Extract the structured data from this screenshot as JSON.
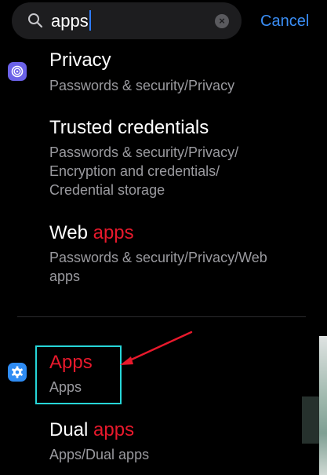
{
  "search": {
    "value": "apps",
    "cancel_label": "Cancel"
  },
  "results": [
    {
      "title_pre": "Privacy",
      "title_hl": "",
      "path_lines": [
        "Passwords & security/Privacy"
      ]
    },
    {
      "title_pre": "Trusted credentials",
      "title_hl": "",
      "path_lines": [
        "Passwords & security/Privacy/",
        "Encryption and credentials/",
        "Credential storage"
      ]
    },
    {
      "title_pre": "Web ",
      "title_hl": "apps",
      "path_lines": [
        "Passwords & security/Privacy/Web",
        "apps"
      ]
    },
    {
      "title_pre": "",
      "title_hl": "Apps",
      "path_lines": [
        "Apps"
      ]
    },
    {
      "title_pre": "Dual ",
      "title_hl": "apps",
      "path_lines": [
        "Apps/Dual apps"
      ]
    }
  ],
  "icons": {
    "search": "search-icon",
    "clear": "clear-icon",
    "privacy": "privacy-icon",
    "settings": "gear-icon"
  },
  "colors": {
    "accent_blue": "#3a8ef6",
    "highlight_red": "#e8192c",
    "annotation_cyan": "#26d6d8",
    "annotation_arrow": "#e8192c"
  }
}
